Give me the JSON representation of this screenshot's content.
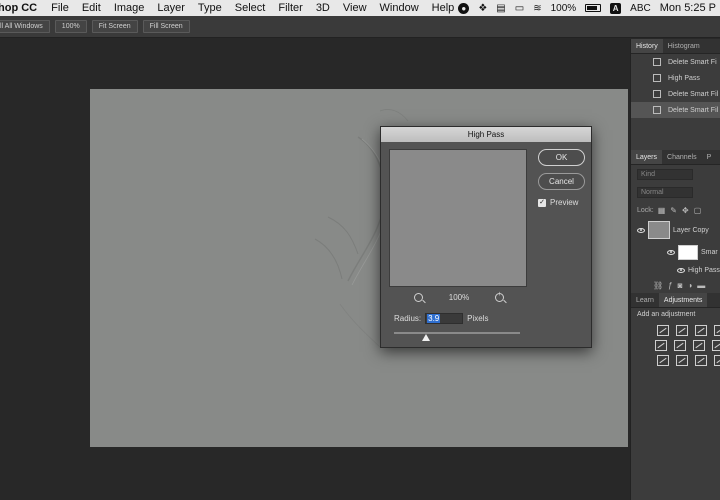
{
  "menubar": {
    "app_name": "hop CC",
    "menus": [
      "File",
      "Edit",
      "Image",
      "Layer",
      "Type",
      "Select",
      "Filter",
      "3D",
      "View",
      "Window",
      "Help"
    ],
    "battery": "100%",
    "input_source": "ABC",
    "clock": "Mon 5:25 P"
  },
  "options_bar": {
    "buttons": [
      "ll All Windows",
      "100%",
      "Fit Screen",
      "Fill Screen"
    ]
  },
  "dialog": {
    "title": "High Pass",
    "ok_label": "OK",
    "cancel_label": "Cancel",
    "preview_label": "Preview",
    "preview_checked": true,
    "zoom_level": "100%",
    "radius_label": "Radius:",
    "radius_value": "3.9",
    "unit_label": "Pixels",
    "slider_position_fraction": 0.25
  },
  "panels": {
    "history": {
      "tabs": [
        "History",
        "Histogram"
      ],
      "items": [
        "Delete Smart Fi",
        "High Pass",
        "Delete Smart Fil",
        "Delete Smart Fil"
      ],
      "active_index": 3
    },
    "layers": {
      "tabs": [
        "Layers",
        "Channels",
        "P"
      ],
      "kind_placeholder": "Kind",
      "blend_mode": "Normal",
      "lock_label": "Lock:",
      "layer_name": "Layer Copy",
      "smart_filters_label": "Smar",
      "filter_name": "High Pass"
    },
    "adjustments": {
      "tabs": [
        "Learn",
        "Adjustments"
      ],
      "add_label": "Add an adjustment"
    }
  },
  "colors": {
    "menubar_bg": "#e8e8e8",
    "app_bg": "#282828",
    "dialog_bg": "#535353",
    "canvas_gray": "#888a88",
    "selection_blue": "#2f6fd0"
  }
}
